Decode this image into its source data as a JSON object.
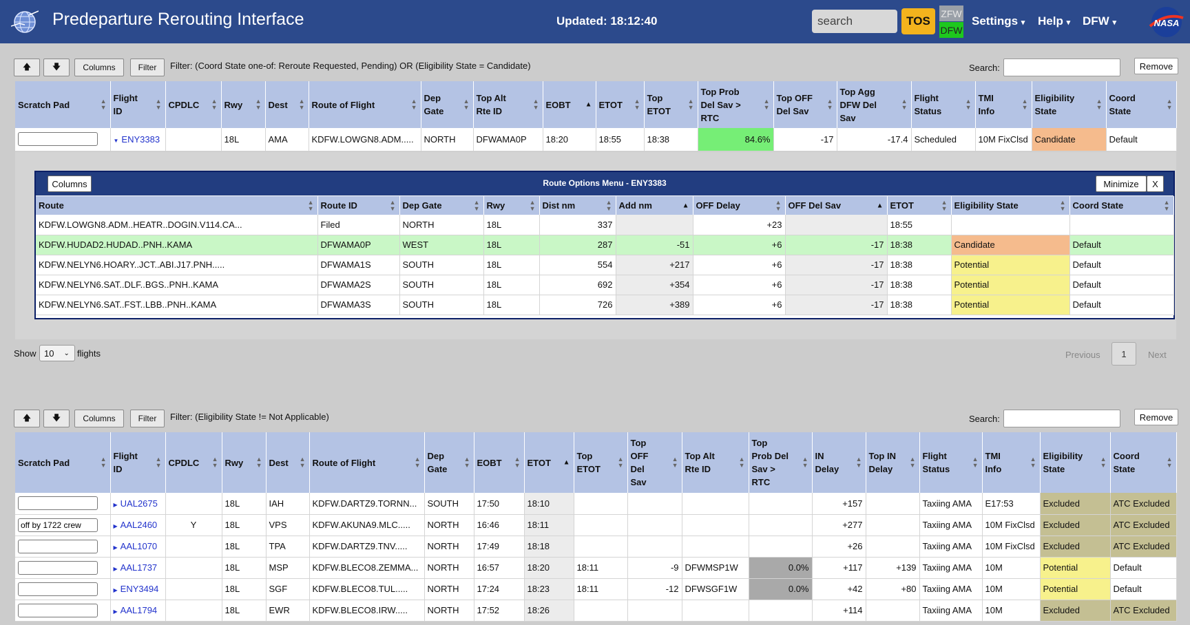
{
  "app": {
    "title": "Predeparture Rerouting Interface",
    "updated": "Updated: 18:12:40",
    "search_placeholder": "search",
    "tos_label": "TOS",
    "zfw_label": "ZFW",
    "dfw_label": "DFW",
    "menus": [
      "Settings",
      "Help",
      "DFW"
    ],
    "logo_text": "NASA"
  },
  "colors": {
    "header_bg": "#2c4a8c",
    "table_header": "#b4c3e4",
    "candidate": "#f5bb8d",
    "potential": "#f7f18c",
    "excluded": "#c4bf93",
    "highlight_green": "#76ee76"
  },
  "table1": {
    "toolbar": {
      "up_icon": "arrow-up-icon",
      "down_icon": "arrow-down-icon",
      "columns_label": "Columns",
      "filter_label": "Filter",
      "filter_text": "Filter: (Coord State one-of: Reroute Requested, Pending) OR (Eligibility State = Candidate)",
      "search_label": "Search:",
      "remove_label": "Remove"
    },
    "headers": [
      [
        "Scratch Pad"
      ],
      [
        "Flight",
        "ID"
      ],
      [
        "CPDLC"
      ],
      [
        "Rwy"
      ],
      [
        "Dest"
      ],
      [
        "Route of Flight"
      ],
      [
        "Dep",
        "Gate"
      ],
      [
        "Top Alt",
        "Rte ID"
      ],
      [
        "EOBT"
      ],
      [
        "ETOT"
      ],
      [
        "Top",
        "ETOT"
      ],
      [
        "Top Prob",
        "Del Sav >",
        "RTC"
      ],
      [
        "Top OFF",
        "Del Sav"
      ],
      [
        "Top Agg",
        "DFW Del",
        "Sav"
      ],
      [
        "Flight",
        "Status"
      ],
      [
        "TMI",
        "Info"
      ],
      [
        "Eligibility",
        "State"
      ],
      [
        "Coord",
        "State"
      ]
    ],
    "rows": [
      {
        "scratch": "",
        "flight": "ENY3383",
        "expanded": true,
        "cpdlc": "",
        "rwy": "18L",
        "dest": "AMA",
        "route": "KDFW.LOWGN8.ADM.....",
        "dep_gate": "NORTH",
        "top_alt": "DFWAMA0P",
        "eobt": "18:20",
        "etot": "18:55",
        "top_etot": "18:38",
        "top_prob": "84.6%",
        "top_off": "-17",
        "top_agg": "-17.4",
        "status": "Scheduled",
        "tmi": "10M FixClsd",
        "elig": "Candidate",
        "coord": "Default"
      }
    ],
    "footer": {
      "show_label": "Show",
      "page_size": "10",
      "flights_label": "flights",
      "previous": "Previous",
      "page": "1",
      "next": "Next"
    }
  },
  "route_options": {
    "columns_label": "Columns",
    "title": "Route Options Menu - ENY3383",
    "minimize_label": "Minimize",
    "close_label": "X",
    "headers": [
      "Route",
      "Route ID",
      "Dep Gate",
      "Rwy",
      "Dist nm",
      "Add nm",
      "OFF Delay",
      "OFF Del Sav",
      "ETOT",
      "Eligibility State",
      "Coord State"
    ],
    "rows": [
      {
        "route": "KDFW.LOWGN8.ADM..HEATR..DOGIN.V114.CA...",
        "id": "Filed",
        "gate": "NORTH",
        "rwy": "18L",
        "dist": "337",
        "add": "",
        "off_delay": "+23",
        "off_sav": "",
        "etot": "18:55",
        "elig": "",
        "coord": ""
      },
      {
        "route": "KDFW.HUDAD2.HUDAD..PNH..KAMA",
        "id": "DFWAMA0P",
        "gate": "WEST",
        "rwy": "18L",
        "dist": "287",
        "add": "-51",
        "off_delay": "+6",
        "off_sav": "-17",
        "etot": "18:38",
        "elig": "Candidate",
        "coord": "Default"
      },
      {
        "route": "KDFW.NELYN6.HOARY..JCT..ABI.J17.PNH.....",
        "id": "DFWAMA1S",
        "gate": "SOUTH",
        "rwy": "18L",
        "dist": "554",
        "add": "+217",
        "off_delay": "+6",
        "off_sav": "-17",
        "etot": "18:38",
        "elig": "Potential",
        "coord": "Default"
      },
      {
        "route": "KDFW.NELYN6.SAT..DLF..BGS..PNH..KAMA",
        "id": "DFWAMA2S",
        "gate": "SOUTH",
        "rwy": "18L",
        "dist": "692",
        "add": "+354",
        "off_delay": "+6",
        "off_sav": "-17",
        "etot": "18:38",
        "elig": "Potential",
        "coord": "Default"
      },
      {
        "route": "KDFW.NELYN6.SAT..FST..LBB..PNH..KAMA",
        "id": "DFWAMA3S",
        "gate": "SOUTH",
        "rwy": "18L",
        "dist": "726",
        "add": "+389",
        "off_delay": "+6",
        "off_sav": "-17",
        "etot": "18:38",
        "elig": "Potential",
        "coord": "Default"
      }
    ]
  },
  "table2": {
    "toolbar": {
      "up_icon": "arrow-up-icon",
      "down_icon": "arrow-down-icon",
      "columns_label": "Columns",
      "filter_label": "Filter",
      "filter_text": "Filter: (Eligibility State != Not Applicable)",
      "search_label": "Search:",
      "remove_label": "Remove"
    },
    "headers": [
      [
        "Scratch Pad"
      ],
      [
        "Flight",
        "ID"
      ],
      [
        "CPDLC"
      ],
      [
        "Rwy"
      ],
      [
        "Dest"
      ],
      [
        "Route of Flight"
      ],
      [
        "Dep",
        "Gate"
      ],
      [
        "EOBT"
      ],
      [
        "ETOT"
      ],
      [
        "Top",
        "ETOT"
      ],
      [
        "Top",
        "OFF",
        "Del",
        "Sav"
      ],
      [
        "Top Alt",
        "Rte ID"
      ],
      [
        "Top",
        "Prob Del",
        "Sav >",
        "RTC"
      ],
      [
        "IN",
        "Delay"
      ],
      [
        "Top IN",
        "Delay"
      ],
      [
        "Flight",
        "Status"
      ],
      [
        "TMI",
        "Info"
      ],
      [
        "Eligibility",
        "State"
      ],
      [
        "Coord",
        "State"
      ]
    ],
    "rows": [
      {
        "scratch": "",
        "flight": "UAL2675",
        "cpdlc": "",
        "rwy": "18L",
        "dest": "IAH",
        "route": "KDFW.DARTZ9.TORNN...",
        "gate": "SOUTH",
        "eobt": "17:50",
        "etot": "18:10",
        "top_etot": "",
        "top_off": "",
        "top_alt": "",
        "top_prob": "",
        "in_delay": "+157",
        "top_in": "",
        "status": "Taxiing AMA",
        "tmi": "E17:53",
        "elig": "Excluded",
        "coord": "ATC Excluded"
      },
      {
        "scratch": "off by 1722 crew",
        "flight": "AAL2460",
        "cpdlc": "Y",
        "rwy": "18L",
        "dest": "VPS",
        "route": "KDFW.AKUNA9.MLC.....",
        "gate": "NORTH",
        "eobt": "16:46",
        "etot": "18:11",
        "top_etot": "",
        "top_off": "",
        "top_alt": "",
        "top_prob": "",
        "in_delay": "+277",
        "top_in": "",
        "status": "Taxiing AMA",
        "tmi": "10M FixClsd",
        "elig": "Excluded",
        "coord": "ATC Excluded"
      },
      {
        "scratch": "",
        "flight": "AAL1070",
        "cpdlc": "",
        "rwy": "18L",
        "dest": "TPA",
        "route": "KDFW.DARTZ9.TNV.....",
        "gate": "NORTH",
        "eobt": "17:49",
        "etot": "18:18",
        "top_etot": "",
        "top_off": "",
        "top_alt": "",
        "top_prob": "",
        "in_delay": "+26",
        "top_in": "",
        "status": "Taxiing AMA",
        "tmi": "10M FixClsd",
        "elig": "Excluded",
        "coord": "ATC Excluded"
      },
      {
        "scratch": "",
        "flight": "AAL1737",
        "cpdlc": "",
        "rwy": "18L",
        "dest": "MSP",
        "route": "KDFW.BLECO8.ZEMMA...",
        "gate": "NORTH",
        "eobt": "16:57",
        "etot": "18:20",
        "top_etot": "18:11",
        "top_off": "-9",
        "top_alt": "DFWMSP1W",
        "top_prob": "0.0%",
        "in_delay": "+117",
        "top_in": "+139",
        "status": "Taxiing AMA",
        "tmi": "10M",
        "elig": "Potential",
        "coord": "Default"
      },
      {
        "scratch": "",
        "flight": "ENY3494",
        "cpdlc": "",
        "rwy": "18L",
        "dest": "SGF",
        "route": "KDFW.BLECO8.TUL.....",
        "gate": "NORTH",
        "eobt": "17:24",
        "etot": "18:23",
        "top_etot": "18:11",
        "top_off": "-12",
        "top_alt": "DFWSGF1W",
        "top_prob": "0.0%",
        "in_delay": "+42",
        "top_in": "+80",
        "status": "Taxiing AMA",
        "tmi": "10M",
        "elig": "Potential",
        "coord": "Default"
      },
      {
        "scratch": "",
        "flight": "AAL1794",
        "cpdlc": "",
        "rwy": "18L",
        "dest": "EWR",
        "route": "KDFW.BLECO8.IRW.....",
        "gate": "NORTH",
        "eobt": "17:52",
        "etot": "18:26",
        "top_etot": "",
        "top_off": "",
        "top_alt": "",
        "top_prob": "",
        "in_delay": "+114",
        "top_in": "",
        "status": "Taxiing AMA",
        "tmi": "10M",
        "elig": "Excluded",
        "coord": "ATC Excluded"
      }
    ]
  }
}
